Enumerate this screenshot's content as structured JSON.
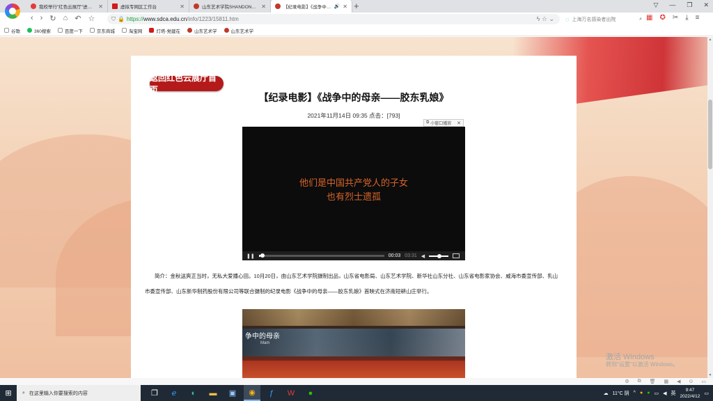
{
  "browser": {
    "tabs": [
      {
        "title": "我校举行\"红色云展厅\"进校园",
        "color": "#e23b3b",
        "active": false
      },
      {
        "title": "虚拟专网区工作台",
        "color": "#d11a1a",
        "active": false
      },
      {
        "title": "山东艺术学院SHANDONG C",
        "color": "#c0392b",
        "active": false
      },
      {
        "title": "【纪录电影】《战争中的母",
        "color": "#c0392b",
        "active": true
      }
    ],
    "new_tab": "+",
    "window_controls": [
      "▽",
      "—",
      "❐",
      "✕"
    ],
    "url": {
      "scheme": "https://",
      "host": "www.sdca.edu.cn",
      "path": "/info/1223/15811.htm"
    },
    "search_placeholder": "上海万名感染者出院",
    "bookmarks": [
      {
        "label": "谷歌",
        "color": "#4285f4"
      },
      {
        "label": "360搜索",
        "color": "#1dbf5a"
      },
      {
        "label": "百度一下",
        "color": "#2d63e6"
      },
      {
        "label": "京东商城",
        "color": "#e1251b"
      },
      {
        "label": "淘宝网",
        "color": "#ff6a00"
      },
      {
        "label": "灯塔-党建在",
        "color": "#d11a1a"
      },
      {
        "label": "山东艺术学",
        "color": "#c0392b"
      },
      {
        "label": "山东艺术学",
        "color": "#c0392b"
      }
    ]
  },
  "page": {
    "back_button": "返回红色云展厅首页",
    "title": "【纪录电影】《战争中的母亲——胶东乳娘》",
    "meta": "2021年11月14日 09:35  点击：[793]",
    "popout_label": "小窗口播放",
    "video": {
      "subtitle_line1": "他们是中国共产党人的子女",
      "subtitle_line2": "也有烈士遗孤",
      "time_current": "00:03",
      "time_total": "03:31",
      "progress": 0.014
    },
    "intro": "简介：金秋送爽正当时，无私大爱播心田。10月20日，由山东艺术学院摄制出品，山东省电影局、山东艺术学院、新华社山东分社、山东省电影家协会、威海市委宣传部、乳山市委宣传部、山东新华制药股份有限公司等联合摄制的纪录电影《战争中的母亲——胶东乳娘》首映式在济南短耕山庄举行。",
    "photo": {
      "caption": "争中的母亲",
      "caption_small": "Mam"
    }
  },
  "watermark": {
    "line1": "激活 Windows",
    "line2": "转到\"设置\"以激活 Windows。"
  },
  "taskbar": {
    "search_placeholder": "在这里输入你要搜索的内容",
    "weather": "11°C 阴",
    "ime": "英",
    "time": "9:47",
    "date": "2022/4/12"
  }
}
